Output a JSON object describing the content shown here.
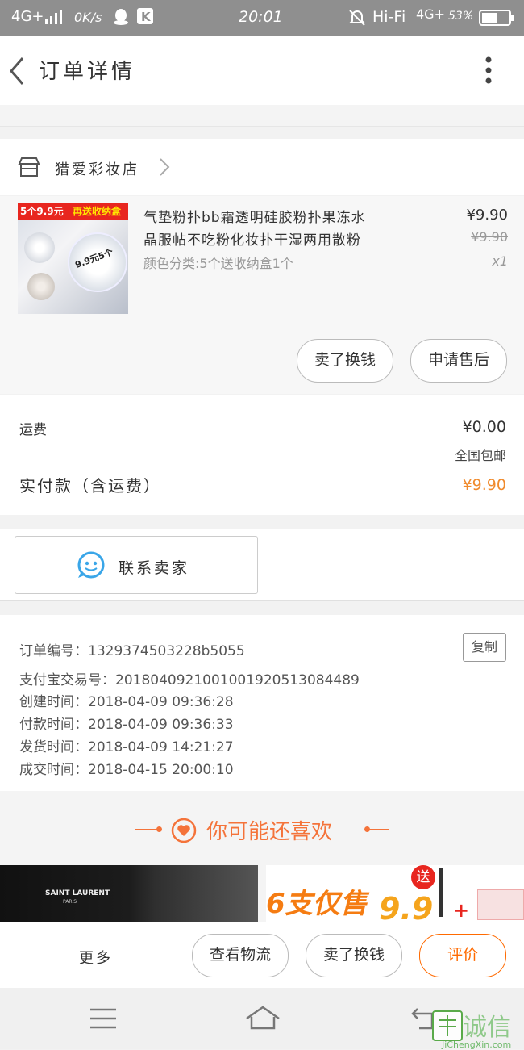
{
  "status_bar": {
    "signal_left": "4G+",
    "speed": "0K/s",
    "time": "20:01",
    "wifi": "Hi-Fi",
    "signal_right": "4G+",
    "battery": "53%"
  },
  "header": {
    "title": "订单详情"
  },
  "shop": {
    "name": "猎爱彩妆店"
  },
  "product": {
    "image_banner": "5个9.9元",
    "image_banner2": "再送收纳盒",
    "image_sticker": "9.9元5个",
    "title_line1": "气垫粉扑bb霜透明硅胶粉扑果冻水",
    "title_line2": "晶服帖不吃粉化妆扑干湿两用散粉",
    "sku": "颜色分类:5个送收纳盒1个",
    "price": "¥9.90",
    "original_price": "¥9.90",
    "quantity": "x1",
    "buttons": {
      "exchange": "卖了换钱",
      "after_sale": "申请售后"
    }
  },
  "fees": {
    "shipping_label": "运费",
    "shipping_value": "¥0.00",
    "shipping_note": "全国包邮",
    "paid_label": "实付款（含运费）",
    "paid_value": "¥9.90"
  },
  "contact": {
    "label": "联系卖家"
  },
  "order_info": {
    "order_no": "订单编号：1329374503228b5055",
    "copy_label": "复制",
    "alipay_no": "支付宝交易号：2018040921001001920513084489",
    "created": "创建时间：2018-04-09  09:36:28",
    "paid": "付款时间：2018-04-09  09:36:33",
    "shipped": "发货时间：2018-04-09  14:21:27",
    "completed": "成交时间：2018-04-15  20:00:10"
  },
  "recommend": {
    "title": "你可能还喜欢",
    "card1_brand": "SAINT LAURENT",
    "card1_sub": "PARIS",
    "card2_text": "6支仅售",
    "card2_badge": "送",
    "card2_price": "9.9"
  },
  "bottom_bar": {
    "more": "更多",
    "logistics": "查看物流",
    "exchange": "卖了换钱",
    "review": "评价"
  },
  "watermark": {
    "text": "诚信",
    "sub": "JiChengXin.com"
  },
  "colors": {
    "accent": "#ff6a00",
    "price_accent": "#f08a2c",
    "contact_icon": "#3aa6e8"
  }
}
